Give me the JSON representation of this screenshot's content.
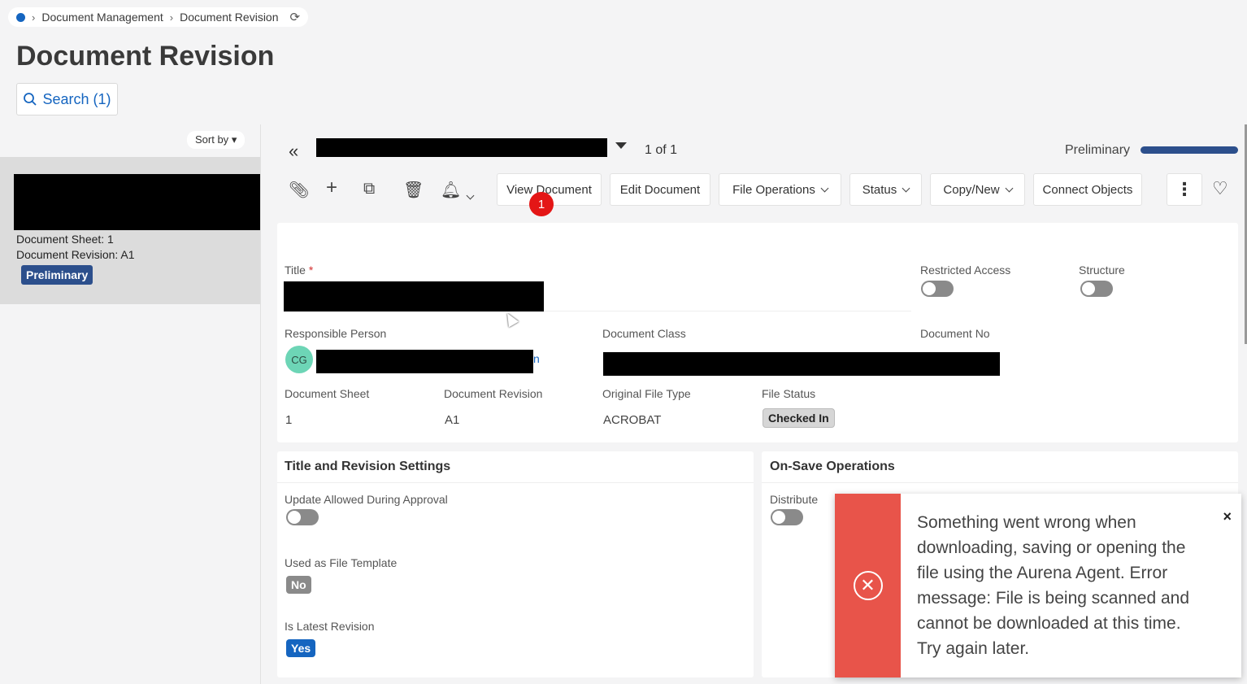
{
  "breadcrumb": {
    "items": [
      "Document Management",
      "Document Revision"
    ]
  },
  "page": {
    "title": "Document Revision"
  },
  "search": {
    "label": "Search (1)"
  },
  "list": {
    "sort_label": "Sort by",
    "item": {
      "sheet_line": "Document Sheet:  1",
      "revision_line": "Document Revision:  A1",
      "status": "Preliminary"
    }
  },
  "record_nav": {
    "count": "1 of 1",
    "state": "Preliminary"
  },
  "toolbar": {
    "view_document": "View Document",
    "edit_document": "Edit Document",
    "file_operations": "File Operations",
    "status": "Status",
    "copy_new": "Copy/New",
    "connect_objects": "Connect Objects",
    "badge_count": "1"
  },
  "form": {
    "title_label": "Title",
    "required_mark": "*",
    "restricted_access_label": "Restricted Access",
    "structure_label": "Structure",
    "responsible_person_label": "Responsible Person",
    "responsible_person_initials": "CG",
    "responsible_person_suffix": "n",
    "document_class_label": "Document Class",
    "document_no_label": "Document No",
    "document_sheet_label": "Document Sheet",
    "document_sheet_value": "1",
    "document_revision_label": "Document Revision",
    "document_revision_value": "A1",
    "original_file_type_label": "Original File Type",
    "original_file_type_value": "ACROBAT",
    "file_status_label": "File Status",
    "file_status_value": "Checked In"
  },
  "title_revision_settings": {
    "heading": "Title and Revision Settings",
    "update_allowed_label": "Update Allowed During Approval",
    "used_as_template_label": "Used as File Template",
    "used_as_template_value": "No",
    "latest_revision_label": "Is Latest Revision",
    "latest_revision_value": "Yes"
  },
  "on_save": {
    "heading": "On-Save Operations",
    "distribute_label": "Distribute"
  },
  "toast": {
    "message": "Something went wrong when downloading, saving or opening the file using the Aurena Agent. Error message: File is being scanned and cannot be downloaded at this time. Try again later.",
    "close": "×"
  },
  "colors": {
    "accent": "#1565c0",
    "status_navy": "#2c4f8c",
    "error": "#e8544a",
    "badge_red": "#e41616"
  }
}
